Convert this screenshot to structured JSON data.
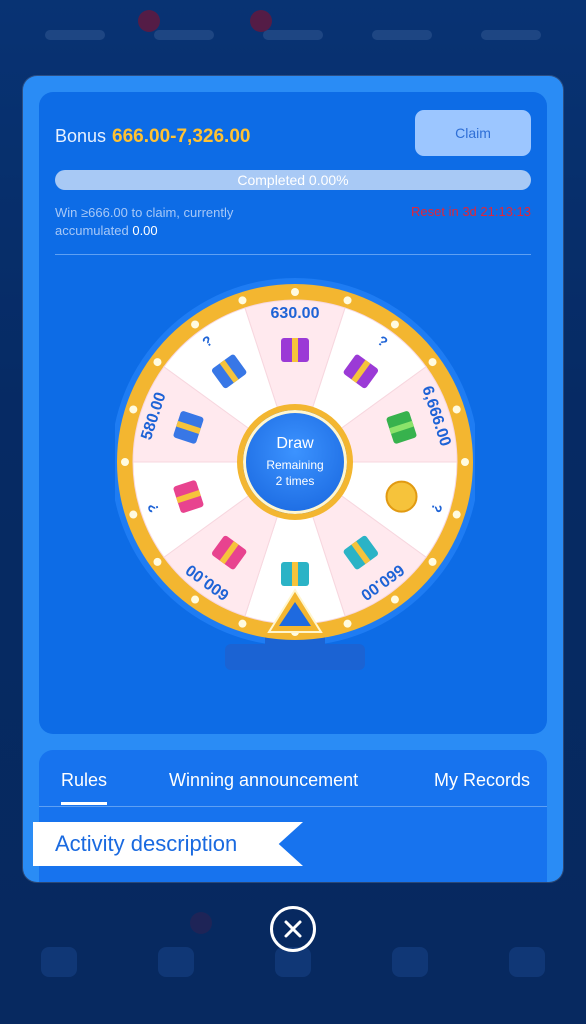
{
  "bonus": {
    "label": "Bonus",
    "value": "666.00-7,326.00"
  },
  "claim_label": "Claim",
  "progress": {
    "text": "Completed 0.00%",
    "fraction": 0.0
  },
  "hint": {
    "text": "Win ≥666.00 to claim, currently accumulated",
    "amount": "0.00"
  },
  "reset_text": "Reset in 3d 21:13:13",
  "wheel": {
    "segments": [
      {
        "label": "630.00",
        "icon": "purple-gift-icon"
      },
      {
        "label": "?",
        "icon": "purple-gift-icon"
      },
      {
        "label": "6,666.00",
        "icon": "green-gift-icon"
      },
      {
        "label": "?",
        "icon": "emoji-coin-icon"
      },
      {
        "label": "660.00",
        "icon": "teal-gift-icon"
      },
      {
        "label": "",
        "icon": "teal-gift-icon"
      },
      {
        "label": "600.00",
        "icon": "pink-gift-icon"
      },
      {
        "label": "?",
        "icon": "pink-gift-icon"
      },
      {
        "label": "580.00",
        "icon": "blue-gift-icon"
      },
      {
        "label": "?",
        "icon": "blue-gift-icon"
      }
    ],
    "draw_title": "Draw",
    "remaining_line1": "Remaining",
    "remaining_line2": "2 times"
  },
  "tabs": [
    {
      "label": "Rules",
      "active": true
    },
    {
      "label": "Winning announcement",
      "active": false
    },
    {
      "label": "My Records",
      "active": false
    }
  ],
  "section_title": "Activity description",
  "colors": {
    "accent": "#ffc233",
    "panel": "#0d6ce6",
    "modal": "#2a8cf5",
    "reset": "#e0263a"
  }
}
